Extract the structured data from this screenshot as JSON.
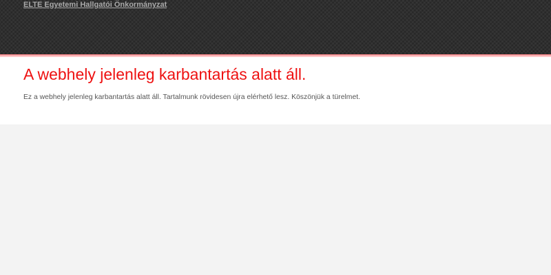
{
  "header": {
    "site_title": "ELTE Egyetemi Hallgatói Önkormányzat"
  },
  "main": {
    "heading": "A webhely jelenleg karbantartás alatt áll.",
    "message": "Ez a webhely jelenleg karbantartás alatt áll. Tartalmunk rövidesen újra elérhető lesz. Köszönjük a türelmet."
  },
  "colors": {
    "header_background": "#2f2f2f",
    "accent": "#ee1111",
    "page_background": "#f3f3f3",
    "content_background": "#ffffff"
  }
}
